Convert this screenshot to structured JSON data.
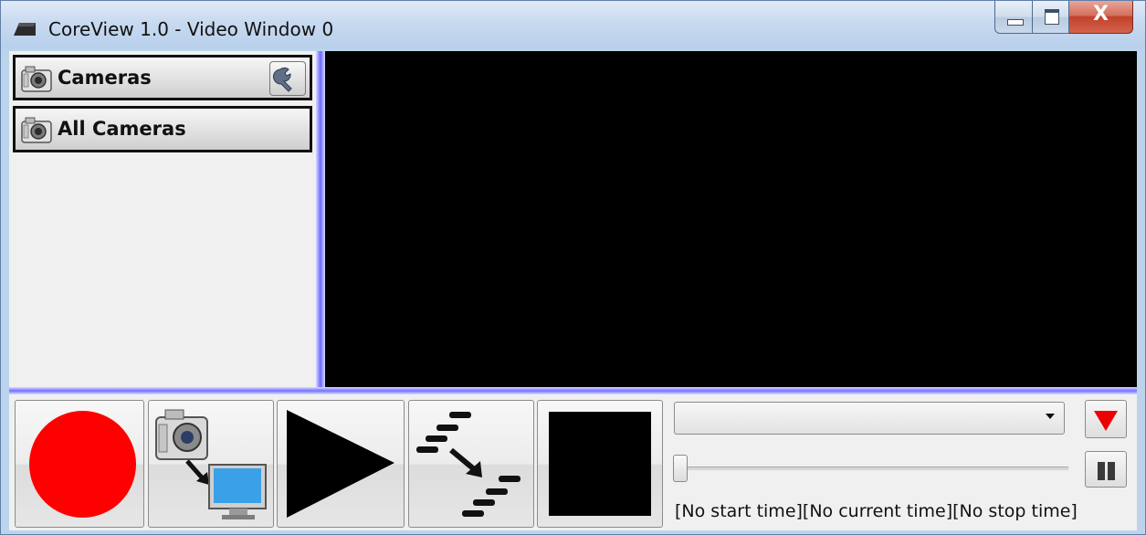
{
  "window": {
    "title": "CoreView 1.0 - Video Window 0",
    "caption_buttons": {
      "minimize_icon": "minimize-icon",
      "maximize_icon": "maximize-icon",
      "close_label": "X"
    }
  },
  "sidebar": {
    "header": {
      "label": "Cameras",
      "icon": "camera-icon",
      "settings_icon": "wrench-icon"
    },
    "items": [
      {
        "label": "All Cameras",
        "icon": "camera-icon"
      }
    ]
  },
  "controls": {
    "buttons": [
      {
        "name": "record",
        "icon": "record-icon",
        "color": "#ff0000"
      },
      {
        "name": "camera-to-monitor",
        "icon": "camera-to-monitor-icon"
      },
      {
        "name": "play",
        "icon": "play-icon"
      },
      {
        "name": "step-sequence",
        "icon": "step-sequence-icon"
      },
      {
        "name": "stop",
        "icon": "stop-icon"
      }
    ],
    "combo": {
      "value": ""
    },
    "down_button": {
      "icon": "down-triangle-icon",
      "color": "#ee0000"
    },
    "slider": {
      "position": 0
    },
    "pause_button": {
      "icon": "pause-icon"
    },
    "time_status": "[No start time][No current time][No stop time]"
  },
  "colors": {
    "splitter": "#7272ff",
    "video_bg": "#000000"
  }
}
